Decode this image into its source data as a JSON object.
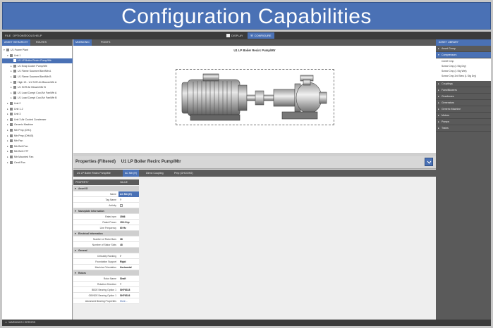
{
  "banner": {
    "title": "Configuration Capabilities"
  },
  "menubar": {
    "items": [
      "FILE",
      "OPTIONS",
      "TOOLS",
      "HELP"
    ],
    "display_label": "DISPLAY",
    "configure_label": "CONFIGURE"
  },
  "left_panel": {
    "tabs": [
      "ASSET HIERARCHY",
      "ROUTES"
    ],
    "tree": [
      {
        "label": "U1 Power Plant"
      },
      {
        "label": "Unit 1"
      },
      {
        "label": "U1 LP Boiler Recirc Pump/Mtr"
      },
      {
        "label": "U1 Evap Cooler Pump/Mtr"
      },
      {
        "label": "U1 Flame Scanner Blwr/Mtr A"
      },
      {
        "label": "U1 Flame Scanner Blwr/Mtr B"
      },
      {
        "label": "High 13 - U1 SCR Air Blower/Mtr A"
      },
      {
        "label": "U1 SCR Air Blower/Mtr B"
      },
      {
        "label": "U1 Load Compt Cool Air Fan/Mtr A"
      },
      {
        "label": "U1 Load Compt Cool Air Fan/Mtr B"
      },
      {
        "label": "Unit 2"
      },
      {
        "label": "Unit 1-2"
      },
      {
        "label": "Unit 3"
      },
      {
        "label": "Unit 3 Air Cooled Condenser"
      },
      {
        "label": "Generic Machine"
      },
      {
        "label": "Mtr Pmp (OH1)"
      },
      {
        "label": "Mtr Pmp (OH4/5)"
      },
      {
        "label": "Mtr Fan"
      },
      {
        "label": "Mtr Belt Fan"
      },
      {
        "label": "Mtr Belt CTF"
      },
      {
        "label": "Mtr Mounted Fan"
      },
      {
        "label": "Centf Fan"
      }
    ]
  },
  "center": {
    "tabs": [
      "MNEMONIC",
      "POINTS"
    ],
    "viewer_title": "U1 LP Boiler Recirc Pump/Mtr",
    "properties": {
      "title": "Properties (Filtered)",
      "subtitle": "U1 LP Boiler Recirc Pump/Mtr",
      "tabs": [
        "U1 LP Boiler Recirc Pump/Mtr",
        "AC Mtr (H)",
        "Direct Coupling",
        "Pmp (OH1/OH2)"
      ],
      "active_tab": 1,
      "columns": [
        "PROPERTY",
        "VALUE"
      ],
      "rows": [
        {
          "section": "Asset ID"
        },
        {
          "label": "Name",
          "value": "AC Mtr (H)",
          "highlight": true
        },
        {
          "label": "Tag Name",
          "value": "?"
        },
        {
          "label": "Activity",
          "value": "",
          "checkbox": true
        },
        {
          "section": "Nameplate Information"
        },
        {
          "label": "Rated rpm",
          "value": "3566"
        },
        {
          "label": "Rated Power",
          "value": "150.0 hp"
        },
        {
          "label": "Line Frequency",
          "value": "60 Hz"
        },
        {
          "section": "Electrical Information"
        },
        {
          "label": "Number of Rotor Bars",
          "value": "38"
        },
        {
          "label": "Number of Stator Slots",
          "value": "48"
        },
        {
          "section": "General"
        },
        {
          "label": "Criticality Ranking",
          "value": "7"
        },
        {
          "label": "Foundation Support",
          "value": "Rigid"
        },
        {
          "label": "Machine Orientation",
          "value": "Horizontal"
        },
        {
          "section": "Rotors"
        },
        {
          "label": "Rotor Name",
          "value": "Shaft"
        },
        {
          "label": "Rotation Direction",
          "value": "?"
        },
        {
          "label": "IB/DE Bearing Option 1",
          "value": "SKF6318"
        },
        {
          "label": "OB/NDE Bearing Option 1",
          "value": "SKF6316"
        },
        {
          "label": "Advanced Bearing Properties",
          "value": "More...",
          "link": true
        }
      ]
    }
  },
  "right_panel": {
    "tab": "ASSET LIBRARY",
    "categories": [
      {
        "label": "Asset Group",
        "open": false
      },
      {
        "label": "Compressors",
        "open": true,
        "items": [
          "Centrf Cmp",
          "Screw Cmp (1 Stg Dry)",
          "Screw Cmp (1 Stg Wet)",
          "Screw Cmp 2rd Stew (1 Stg Dry)"
        ]
      },
      {
        "label": "Couplings",
        "open": false
      },
      {
        "label": "Fans/Blowers",
        "open": false
      },
      {
        "label": "Gearboxes",
        "open": false
      },
      {
        "label": "Generators",
        "open": false
      },
      {
        "label": "Generic Machine",
        "open": false
      },
      {
        "label": "Motors",
        "open": false
      },
      {
        "label": "Pumps",
        "open": false
      },
      {
        "label": "Trains",
        "open": false
      }
    ]
  },
  "status_bar": {
    "label": "WARNINGS / ERRORS"
  },
  "colors": {
    "accent": "#4a71b5",
    "dark_bar": "#3b3b3b",
    "panel_bar": "#5a5a5a"
  }
}
